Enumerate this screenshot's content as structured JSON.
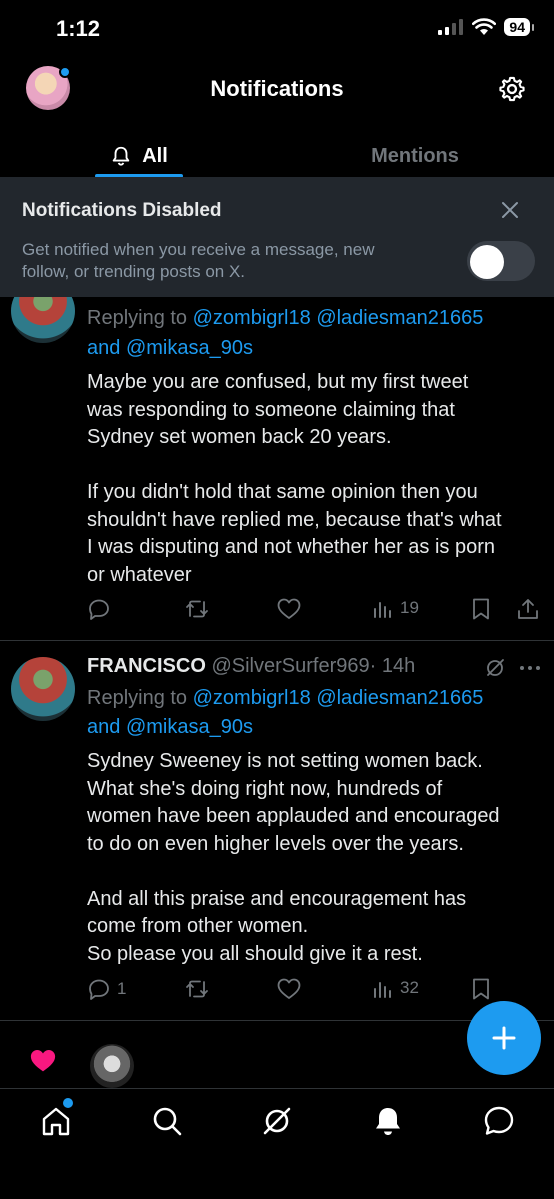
{
  "status_bar": {
    "time": "1:12",
    "battery": "94"
  },
  "header": {
    "title": "Notifications"
  },
  "tabs": [
    {
      "label": "All",
      "active": true
    },
    {
      "label": "Mentions",
      "active": false
    }
  ],
  "banner": {
    "title": "Notifications Disabled",
    "line1": "Get notified when you receive a message, new",
    "line2": "follow, or trending posts on X.",
    "toggle_on": false
  },
  "tweets": [
    {
      "replying_prefix": "Replying to",
      "mention1": "@zombigrl18",
      "mention2": "@ladiesman21665",
      "and": "and",
      "mention3": "@mikasa_90s",
      "body": [
        "Maybe you are confused, but my first tweet",
        "was responding to someone claiming that",
        "Sydney set women back 20 years.",
        "",
        "If you didn't hold that same opinion then you",
        "shouldn't have replied me, because that's what",
        "I was disputing and not whether her as is porn",
        "or whatever"
      ],
      "replies": "",
      "views": "19"
    },
    {
      "name": "FRANCISCO",
      "handle": "@SilverSurfer969",
      "time": "· 14h",
      "replying_prefix": "Replying to",
      "mention1": "@zombigrl18",
      "mention2": "@ladiesman21665",
      "and": "and",
      "mention3": "@mikasa_90s",
      "body": [
        "Sydney Sweeney is not setting women back.",
        "What she's doing right now, hundreds of",
        "women have been applauded and encouraged",
        "to do on even higher levels over the years.",
        "",
        "And all this praise and encouragement has",
        "come from other women.",
        "So please you all should give it a rest."
      ],
      "replies": "1",
      "views": "32"
    }
  ],
  "icons": {
    "settings": "gear-icon",
    "bell": "bell-icon",
    "close": "close-icon",
    "reply": "reply-icon",
    "retweet": "retweet-icon",
    "like": "heart-icon",
    "views": "views-icon",
    "bookmark": "bookmark-icon",
    "share": "share-icon",
    "compose": "plus-icon",
    "nav": [
      "home-icon",
      "search-icon",
      "grok-icon",
      "notifications-icon",
      "messages-icon"
    ]
  },
  "colors": {
    "accent": "#1d9bf0",
    "like": "#f91880",
    "background": "#000000",
    "banner": "#22272d"
  }
}
